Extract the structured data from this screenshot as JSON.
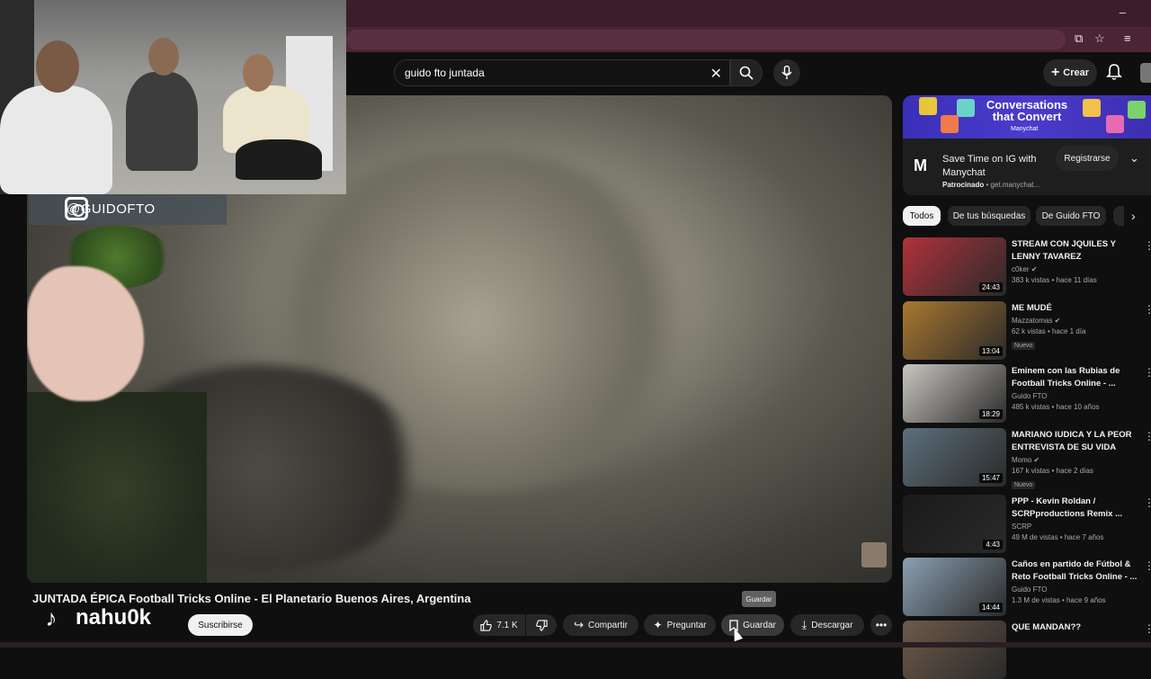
{
  "browser": {
    "minimize_glyph": "–",
    "icons": [
      "screenshot-icon",
      "star-icon",
      "playlist-icon"
    ]
  },
  "header": {
    "search_value": "guido fto juntada",
    "create_label": "Crear"
  },
  "overlay": {
    "instagram_handle": "@GUIDOFTO",
    "tiktok_handle": "nahu0k"
  },
  "video": {
    "title": "JUNTADA ÉPICA Football Tricks Online - El Planetario Buenos Aires, Argentina",
    "subscribe_label": "Suscribirse",
    "likes": "7.1 K",
    "share_label": "Compartir",
    "ask_label": "Preguntar",
    "save_label": "Guardar",
    "download_label": "Descargar",
    "tooltip": "Guardar"
  },
  "ad": {
    "banner_text": "Conversations that Convert",
    "banner_sub": "Manychat",
    "title": "Save Time on IG with Manychat",
    "sponsored": "Patrocinado",
    "domain": "get.manychat...",
    "register_label": "Registrarse",
    "accent": "#3a2fb8"
  },
  "chips": [
    "Todos",
    "De tus búsquedas",
    "De Guido FTO"
  ],
  "recommendations": [
    {
      "title": "STREAM CON JQUILES Y LENNY TAVAREZ",
      "channel": "c0ker ✔",
      "stats": "383 k vistas • hace 11 días",
      "duration": "24:43",
      "badge": "",
      "color": "#b0323a"
    },
    {
      "title": "ME MUDÉ",
      "channel": "Mazzatomas ✔",
      "stats": "62 k vistas • hace 1 día",
      "duration": "13:04",
      "badge": "Nuevo",
      "color": "#a9782f"
    },
    {
      "title": "Eminem con las Rubias de Football Tricks Online - ...",
      "channel": "Guido FTO",
      "stats": "485 k vistas • hace 10 años",
      "duration": "18:29",
      "badge": "",
      "color": "#c9c6c0"
    },
    {
      "title": "MARIANO IUDICA Y LA PEOR ENTREVISTA DE SU VIDA",
      "channel": "Momo ✔",
      "stats": "167 k vistas • hace 2 días",
      "duration": "15:47",
      "badge": "Nuevo",
      "color": "#5d6f7a"
    },
    {
      "title": "PPP - Kevin Roldan / SCRPproductions Remix ...",
      "channel": "SCRP",
      "stats": "49 M de vistas • hace 7 años",
      "duration": "4:43",
      "badge": "",
      "color": "#1a1a1a"
    },
    {
      "title": "Caños en partido de Fútbol & Reto Football Tricks Online - ...",
      "channel": "Guido FTO",
      "stats": "1.3 M de vistas • hace 9 años",
      "duration": "14:44",
      "badge": "",
      "color": "#8ba0b2"
    },
    {
      "title": "QUE MANDAN??",
      "channel": "",
      "stats": "",
      "duration": "",
      "badge": "",
      "color": "#6e5a4a"
    }
  ]
}
